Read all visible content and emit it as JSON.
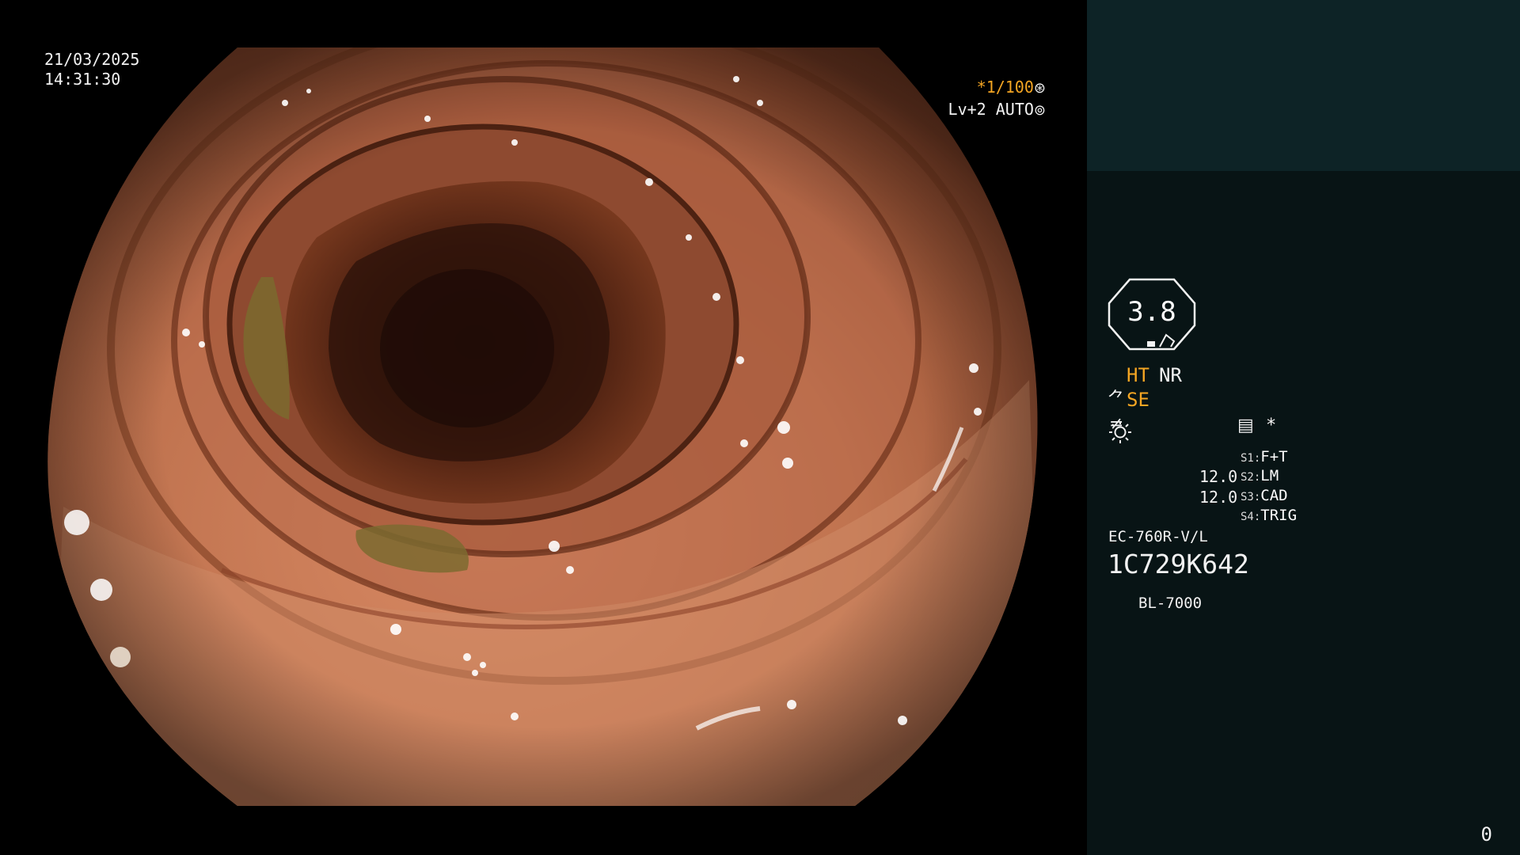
{
  "osd": {
    "date": "21/03/2025",
    "time": "14:31:30",
    "shutter_prefix": "*",
    "shutter": "1/100",
    "shutter_icon": "aperture-icon",
    "level": "Lv+2 AUTO",
    "level_icon": "iris-icon"
  },
  "panel": {
    "ht": "HT",
    "nr": "NR",
    "se_icon": "structure-enhance-icon",
    "se": "SE",
    "signal_icon": "signal-icon",
    "memo_icon": "memo-icon",
    "memo_star": "*",
    "zoom_value": "3.8",
    "value_1": "12.0",
    "value_2": "12.0",
    "switches": [
      {
        "key": "S1:",
        "value": "F+T"
      },
      {
        "key": "S2:",
        "value": "LM"
      },
      {
        "key": "S3:",
        "value": "CAD"
      },
      {
        "key": "S4:",
        "value": "TRIG"
      }
    ],
    "scope_model": "EC-760R-V/L",
    "scope_serial": "1C729K642",
    "light_icon": "sun-icon",
    "light_model": "BL-7000",
    "frame_counter": "0"
  },
  "colors": {
    "accent": "#f5a623",
    "panel_top": "#0d2326",
    "panel_bottom": "#081415",
    "text": "#f2f2f2"
  }
}
